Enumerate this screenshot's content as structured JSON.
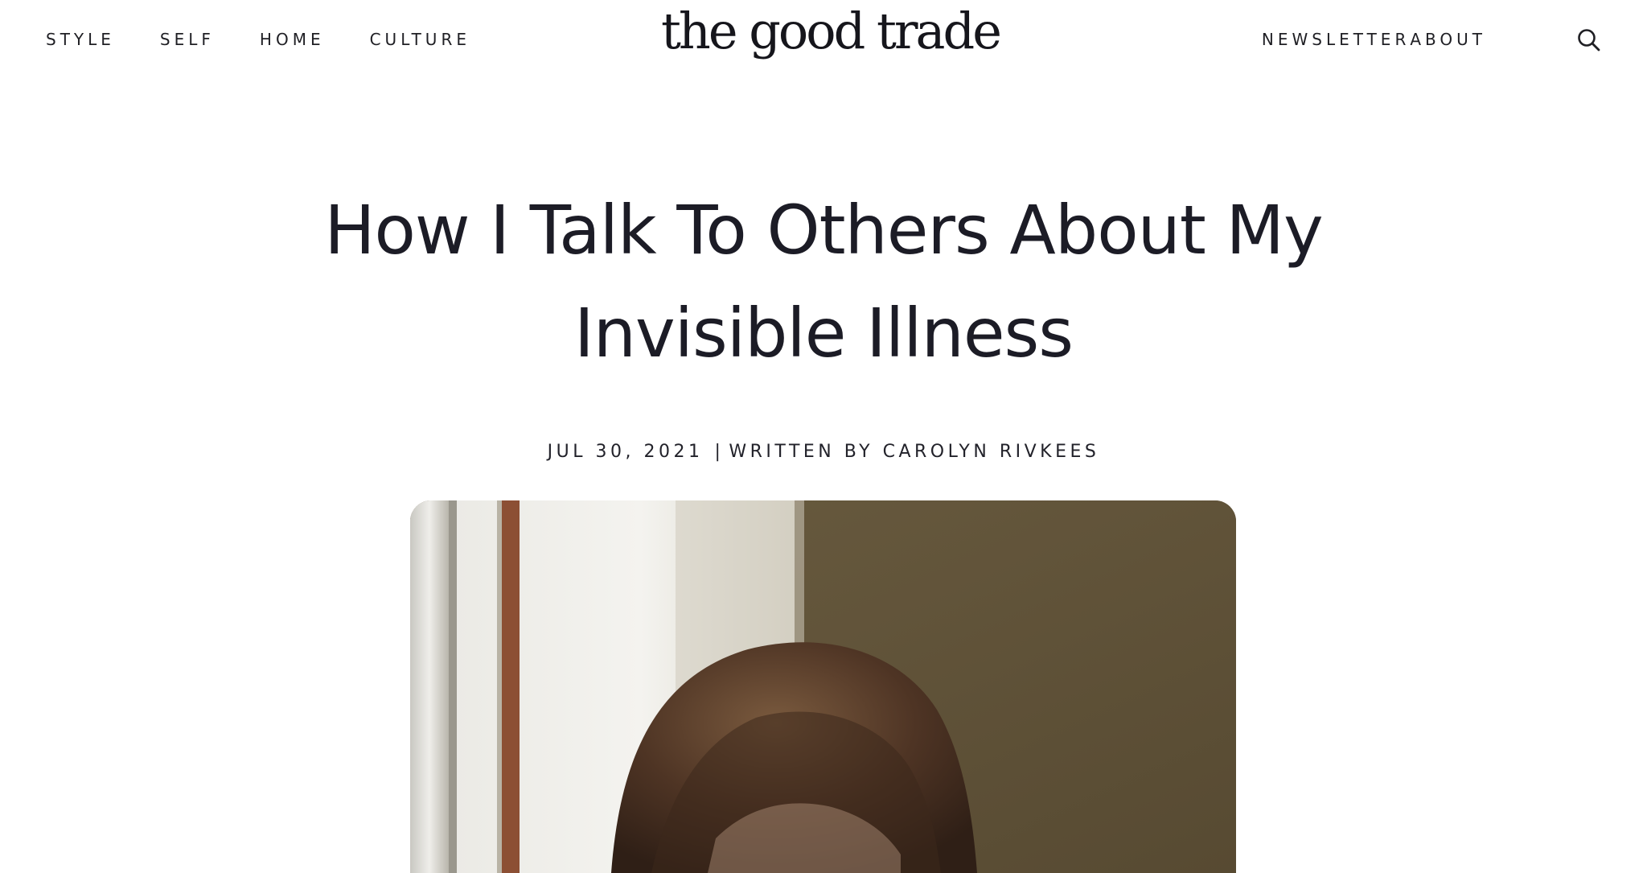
{
  "header": {
    "logo_text": "the good trade",
    "nav_left": [
      {
        "label": "STYLE"
      },
      {
        "label": "SELF"
      },
      {
        "label": "HOME"
      },
      {
        "label": "CULTURE"
      }
    ],
    "nav_right": [
      {
        "label": "NEWSLETTER"
      },
      {
        "label": "ABOUT"
      }
    ],
    "search_icon": "search-icon"
  },
  "article": {
    "title": "How I Talk To Others About My Invisible Illness",
    "date": "JUL 30, 2021",
    "separator": "|",
    "byline": "WRITTEN BY CAROLYN RIVKEES"
  },
  "hero": {
    "image": "woman-with-brown-hair-photo"
  },
  "colors": {
    "text": "#1d1d24",
    "background": "#ffffff",
    "photo_wall": "#5e5139"
  }
}
